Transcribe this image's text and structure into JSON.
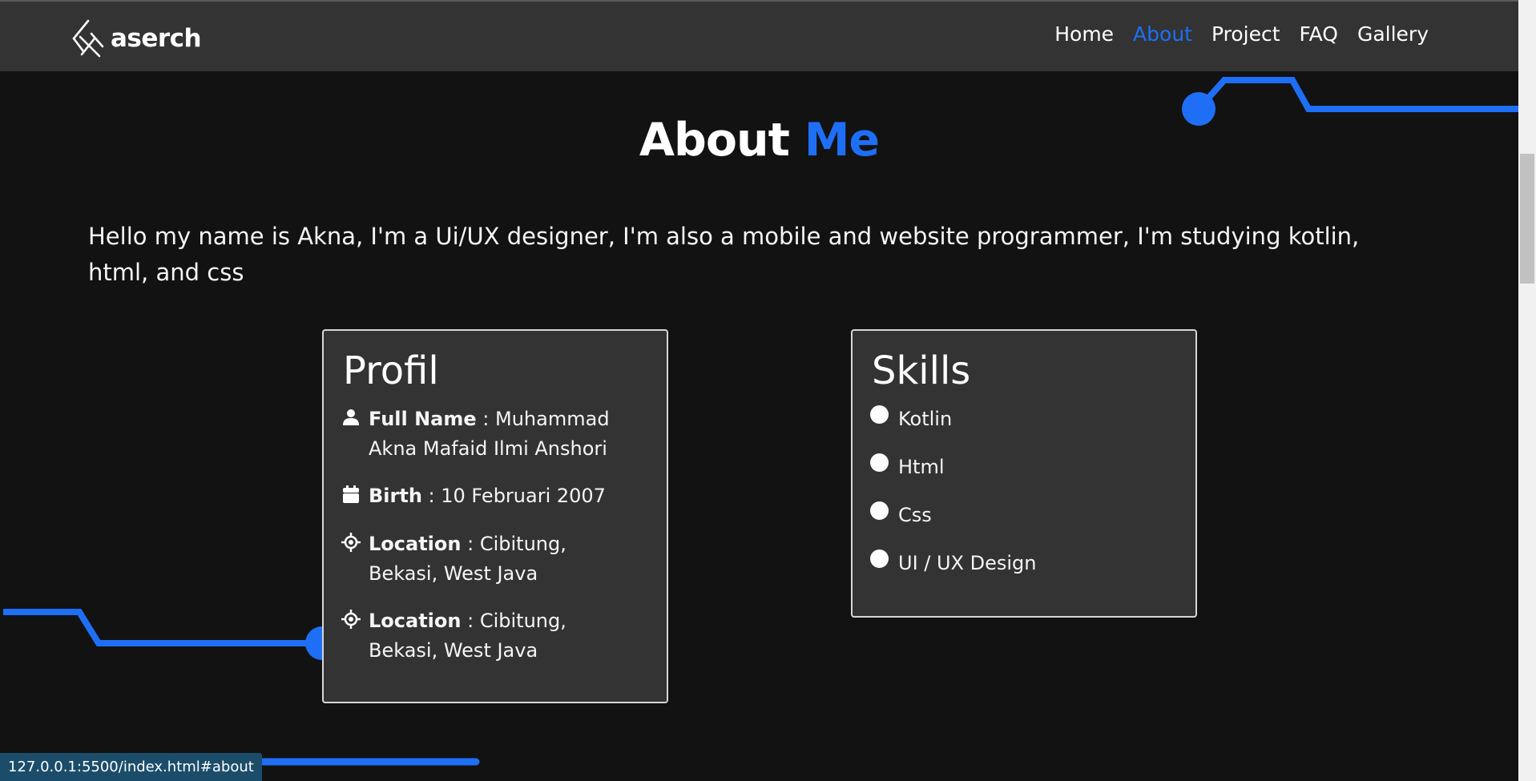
{
  "brand": {
    "name": "aserch"
  },
  "nav": {
    "items": [
      {
        "label": "Home"
      },
      {
        "label": "About"
      },
      {
        "label": "Project"
      },
      {
        "label": "FAQ"
      },
      {
        "label": "Gallery"
      }
    ],
    "active": "About"
  },
  "about": {
    "title_main": "About",
    "title_accent": "Me",
    "intro": "Hello my name is Akna, I'm a Ui/UX designer, I'm also a mobile and website programmer, I'm studying kotlin, html, and css"
  },
  "profil": {
    "title": "Profil",
    "rows": [
      {
        "icon": "user-icon",
        "label": "Full Name",
        "sep": " : ",
        "value": "Muhammad Akna Mafaid Ilmi Anshori"
      },
      {
        "icon": "calendar-icon",
        "label": "Birth",
        "sep": " : ",
        "value": "10 Februari 2007"
      },
      {
        "icon": "location-target-icon",
        "label": "Location",
        "sep": " : ",
        "value": "Cibitung, Bekasi, West Java"
      },
      {
        "icon": "location-target-icon",
        "label": "Location",
        "sep": " : ",
        "value": "Cibitung, Bekasi, West Java"
      }
    ]
  },
  "skills": {
    "title": "Skills",
    "items": [
      "Kotlin",
      "Html",
      "Css",
      "UI / UX Design"
    ]
  },
  "status": {
    "url": "127.0.0.1:5500/index.html#about"
  },
  "colors": {
    "accent": "#1e6ff5",
    "background": "#121212",
    "navbar": "#333333",
    "card": "#333333",
    "status_bar": "#1b4d6b"
  }
}
